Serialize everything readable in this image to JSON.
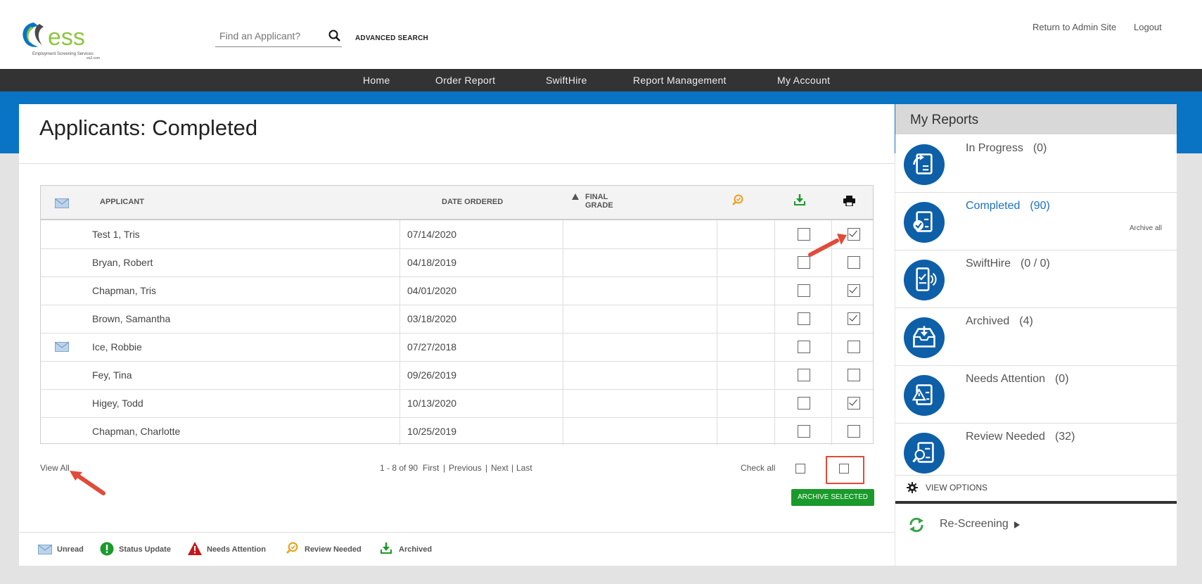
{
  "logo": {
    "brand": "ess",
    "subtitle": "Employment Screening Services",
    "domain": "es2.com"
  },
  "search": {
    "placeholder": "Find an Applicant?",
    "advanced_label": "ADVANCED SEARCH"
  },
  "top_links": {
    "return_admin": "Return to Admin Site",
    "logout": "Logout"
  },
  "nav": {
    "items": [
      "Home",
      "Order Report",
      "SwiftHire",
      "Report Management",
      "My Account"
    ]
  },
  "page": {
    "title": "Applicants: Completed"
  },
  "table": {
    "headers": {
      "applicant": "APPLICANT",
      "date_ordered": "DATE ORDERED",
      "final_grade_1": "FINAL",
      "final_grade_2": "GRADE"
    },
    "rows": [
      {
        "unread": false,
        "applicant": "Test 1, Tris",
        "date": "07/14/2020",
        "archive": false,
        "print": true
      },
      {
        "unread": false,
        "applicant": "Bryan, Robert",
        "date": "04/18/2019",
        "archive": false,
        "print": false
      },
      {
        "unread": false,
        "applicant": "Chapman, Tris",
        "date": "04/01/2020",
        "archive": false,
        "print": true
      },
      {
        "unread": false,
        "applicant": "Brown, Samantha",
        "date": "03/18/2020",
        "archive": false,
        "print": true
      },
      {
        "unread": true,
        "applicant": "Ice, Robbie",
        "date": "07/27/2018",
        "archive": false,
        "print": false
      },
      {
        "unread": false,
        "applicant": "Fey, Tina",
        "date": "09/26/2019",
        "archive": false,
        "print": false
      },
      {
        "unread": false,
        "applicant": "Higey, Todd",
        "date": "10/13/2020",
        "archive": false,
        "print": true
      },
      {
        "unread": false,
        "applicant": "Chapman, Charlotte",
        "date": "10/25/2019",
        "archive": false,
        "print": false
      }
    ]
  },
  "footer": {
    "view_all": "View All",
    "range": "1 - 8 of 90",
    "first": "First",
    "previous": "Previous",
    "next": "Next",
    "last": "Last",
    "check_all": "Check all",
    "archive_selected": "ARCHIVE SELECTED"
  },
  "legend": {
    "unread": "Unread",
    "status_update": "Status Update",
    "needs_attention": "Needs Attention",
    "review_needed": "Review Needed",
    "archived": "Archived"
  },
  "sidebar": {
    "title": "My Reports",
    "items": [
      {
        "label": "In Progress",
        "count": "(0)"
      },
      {
        "label": "Completed",
        "count": "(90)",
        "sub": "Archive all"
      },
      {
        "label": "SwiftHire",
        "count": "(0 / 0)"
      },
      {
        "label": "Archived",
        "count": "(4)"
      },
      {
        "label": "Needs Attention",
        "count": "(0)"
      },
      {
        "label": "Review Needed",
        "count": "(32)"
      }
    ],
    "view_options": "VIEW OPTIONS",
    "rescreening": "Re-Screening"
  },
  "colors": {
    "nav_bg": "#333333",
    "brand_blue": "#0a74c4",
    "icon_blue": "#0d5fa8",
    "archive_green": "#1a9a2a",
    "highlight_red": "#e24a3a",
    "review_orange": "#e9a21b"
  }
}
